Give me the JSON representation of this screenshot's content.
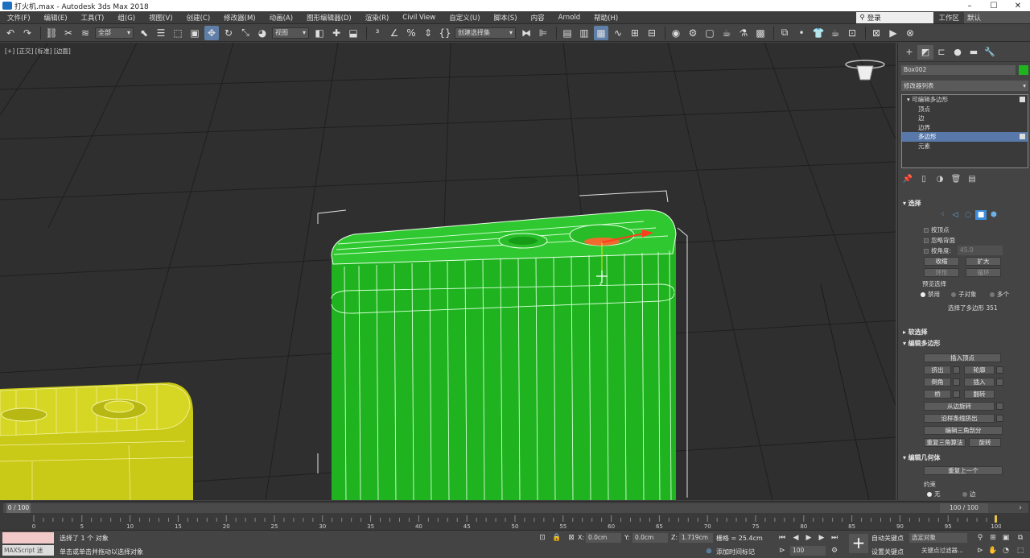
{
  "window": {
    "title": "打火机.max - Autodesk 3ds Max 2018",
    "min": "–",
    "max": "☐",
    "close": "✕"
  },
  "menu": {
    "items": [
      "文件(F)",
      "编辑(E)",
      "工具(T)",
      "组(G)",
      "视图(V)",
      "创建(C)",
      "修改器(M)",
      "动画(A)",
      "图形编辑器(D)",
      "渲染(R)",
      "Civil View",
      "自定义(U)",
      "脚本(S)",
      "内容",
      "Arnold",
      "帮助(H)"
    ],
    "login": "登录",
    "workspace_label": "工作区",
    "workspace_value": "默认"
  },
  "toolbar": {
    "filter": "全部",
    "refcoord": "视图",
    "selset": "创建选择集",
    "icons": {
      "undo": "undo-icon",
      "redo": "redo-icon",
      "link": "link-icon",
      "unlink": "unlink-icon",
      "bind": "bind-spacewarp-icon",
      "select": "select-icon",
      "selbyname": "select-by-name-icon",
      "rect": "rect-region-icon",
      "window": "window-crossing-icon",
      "move": "move-icon",
      "rotate": "rotate-icon",
      "scale": "scale-icon",
      "place": "place-icon",
      "pivot": "pivot-icon",
      "manip": "manipulate-icon",
      "keyb": "keyboard-icon",
      "snap": "snap-icon",
      "angsnap": "angle-snap-icon",
      "pctsnap": "percent-snap-icon",
      "spinsnap": "spinner-snap-icon",
      "editnamed": "edit-named-icon",
      "mirror": "mirror-icon",
      "align": "align-icon",
      "layers": "layers-icon",
      "ribbon": "ribbon-icon",
      "curve": "curve-editor-icon",
      "schem": "schematic-icon",
      "material": "material-editor-icon",
      "rsetup": "render-setup-icon",
      "rframe": "render-frame-icon",
      "render": "render-icon"
    }
  },
  "viewport": {
    "label": "[+] [正交] [标准] [边面]",
    "colors": {
      "green": "#1fb31f",
      "yellow": "#c9c917",
      "bg": "#2f2f2f"
    }
  },
  "command_panel": {
    "object_name": "Box002",
    "object_color": "#1fb31f",
    "modifier_list": "修改器列表",
    "stack": {
      "root": "可编辑多边形",
      "items": [
        "顶点",
        "边",
        "边界",
        "多边形",
        "元素"
      ],
      "selected": "多边形"
    },
    "selection": {
      "title": "选择",
      "by_vertex": "按顶点",
      "ignore_backface": "忽略背面",
      "by_angle": "按角度:",
      "angle_value": "45.0",
      "shrink": "收缩",
      "grow": "扩大",
      "ring": "环形",
      "loop": "循环",
      "preview_title": "预览选择",
      "preview_off": "禁用",
      "preview_sub": "子对象",
      "preview_multi": "多个",
      "status": "选择了多边形 351"
    },
    "soft_selection": {
      "title": "软选择"
    },
    "edit_polygons": {
      "title": "编辑多边形",
      "insert_vertex": "插入顶点",
      "extrude": "挤出",
      "outline": "轮廓",
      "bevel": "倒角",
      "inset": "插入",
      "bridge": "桥",
      "flip": "翻转",
      "hinge": "从边旋转",
      "extrude_spline": "沿样条线挤出",
      "edit_tri": "编辑三角剖分",
      "retri": "重复三角算法",
      "turn": "旋转"
    },
    "edit_geometry": {
      "title": "编辑几何体",
      "repeat_last": "重复上一个",
      "constraints": "约束",
      "none": "无",
      "edge": "边"
    }
  },
  "timeline": {
    "thumb": "0 / 100",
    "frames": "100 / 100",
    "ticks": [
      "0",
      "5",
      "10",
      "15",
      "20",
      "25",
      "30",
      "35",
      "40",
      "45",
      "50",
      "55",
      "60",
      "65",
      "70",
      "75",
      "80",
      "85",
      "90",
      "95",
      "100"
    ]
  },
  "status": {
    "script": "MAXScript 迷",
    "selected": "选择了 1 个 对象",
    "prompt": "单击或单击并拖动以选择对象",
    "x_label": "X:",
    "x": "0.0cm",
    "y_label": "Y:",
    "y": "0.0cm",
    "z_label": "Z:",
    "z": "1.719cm",
    "grid": "栅格 = 25.4cm",
    "add_time_tag": "添加时间标记",
    "frame": "100",
    "auto_key": "自动关键点",
    "set_key": "设置关键点",
    "key_selected": "选定对象",
    "key_filters": "关键点过滤器..."
  }
}
